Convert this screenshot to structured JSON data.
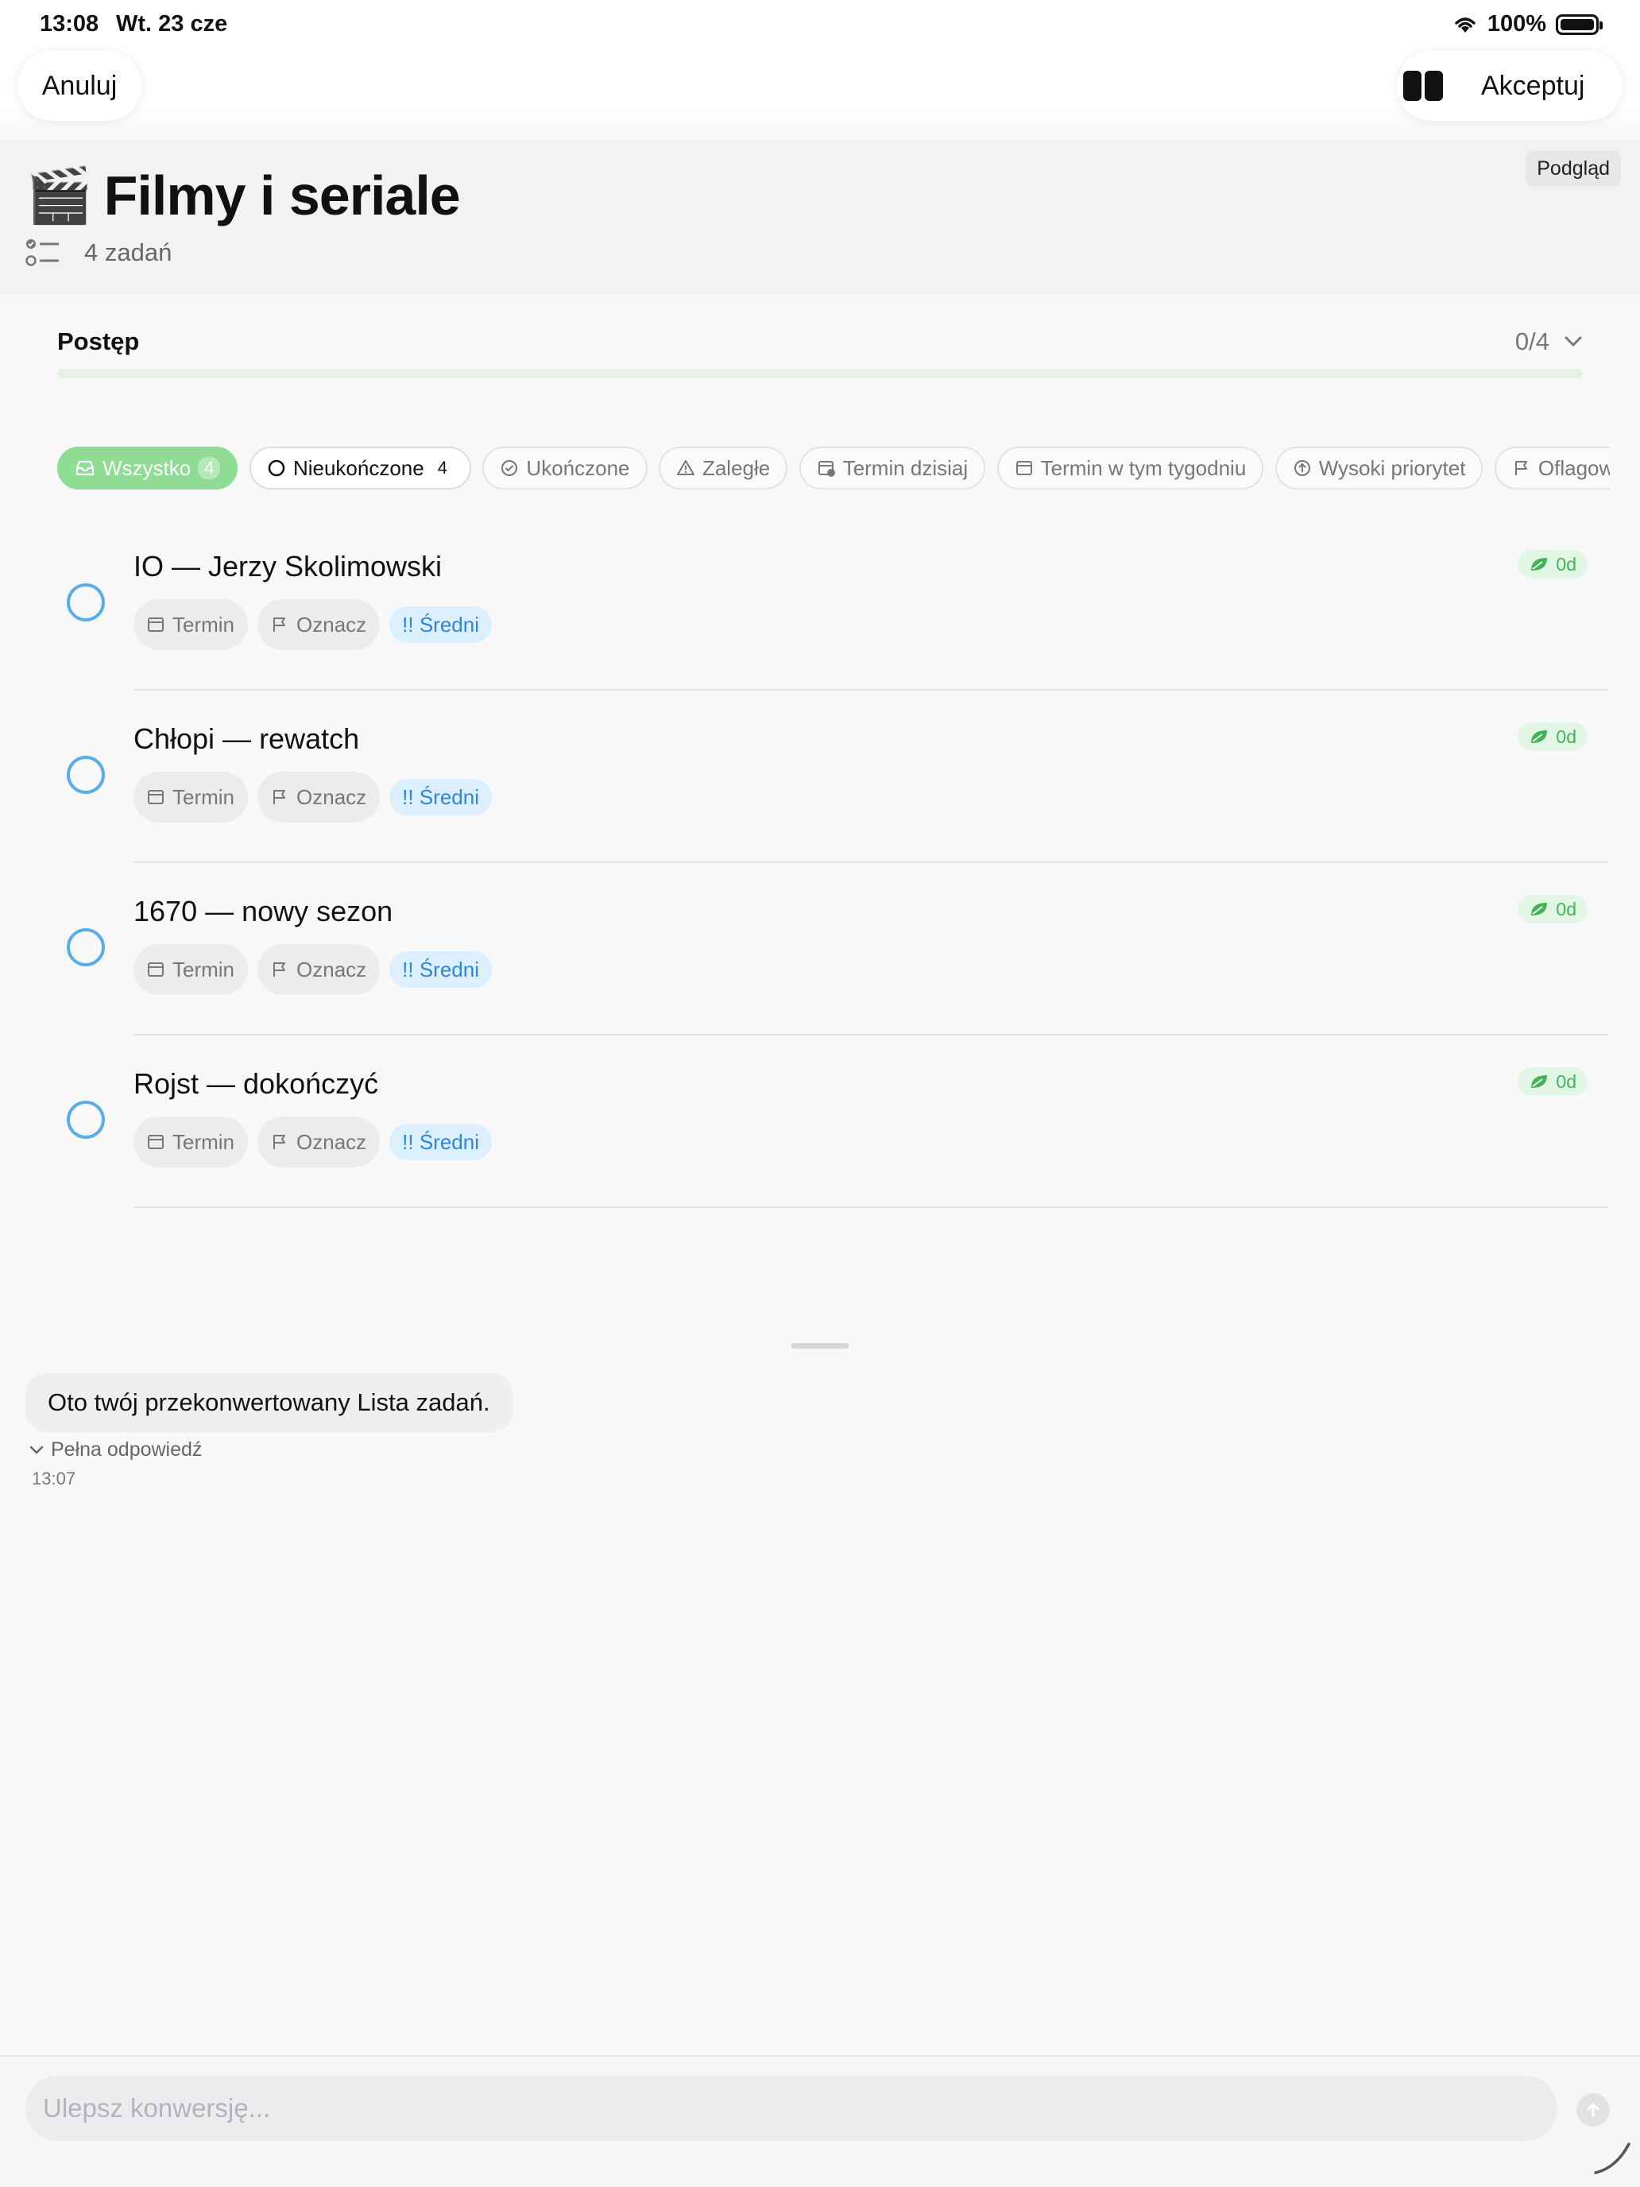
{
  "status_bar": {
    "time": "13:08",
    "date": "Wt. 23 cze",
    "battery": "100%"
  },
  "nav": {
    "cancel_label": "Anuluj",
    "accept_label": "Akceptuj",
    "split_icon": "split-view-icon"
  },
  "header": {
    "preview_badge": "Podgląd",
    "emoji": "🎬",
    "title": "Filmy i seriale",
    "task_count": "4 zadań"
  },
  "progress": {
    "label": "Postęp",
    "value": "0/4",
    "completed_fraction": 0
  },
  "filters": [
    {
      "label": "Wszystko",
      "count": "4",
      "icon": "tray-icon",
      "active": true
    },
    {
      "label": "Nieukończone",
      "count": "4",
      "icon": "circle-icon"
    },
    {
      "label": "Ukończone",
      "icon": "check-circle-icon"
    },
    {
      "label": "Zaległe",
      "icon": "warning-icon"
    },
    {
      "label": "Termin dzisiaj",
      "icon": "calendar-clock-icon"
    },
    {
      "label": "Termin w tym tygodniu",
      "icon": "calendar-icon"
    },
    {
      "label": "Wysoki priorytet",
      "icon": "arrow-up-circle-icon"
    },
    {
      "label": "Oflagowane",
      "icon": "flag-icon"
    }
  ],
  "tasks": [
    {
      "title": "IO — Jerzy Skolimowski",
      "due_label": "Termin",
      "flag_label": "Oznacz",
      "priority": "!! Średni",
      "age": "0d"
    },
    {
      "title": "Chłopi — rewatch",
      "due_label": "Termin",
      "flag_label": "Oznacz",
      "priority": "!! Średni",
      "age": "0d"
    },
    {
      "title": "1670 — nowy sezon",
      "due_label": "Termin",
      "flag_label": "Oznacz",
      "priority": "!! Średni",
      "age": "0d"
    },
    {
      "title": "Rojst — dokończyć",
      "due_label": "Termin",
      "flag_label": "Oznacz",
      "priority": "!! Średni",
      "age": "0d"
    }
  ],
  "chat": {
    "message": "Oto twój przekonwertowany Lista zadań.",
    "full_answer_label": "Pełna odpowiedź",
    "time": "13:07",
    "input_placeholder": "Ulepsz konwersję...",
    "input_value": ""
  },
  "colors": {
    "accent_green": "#8fdc95",
    "check_blue": "#5aaee8",
    "priority_blue": "#2d86d8"
  }
}
